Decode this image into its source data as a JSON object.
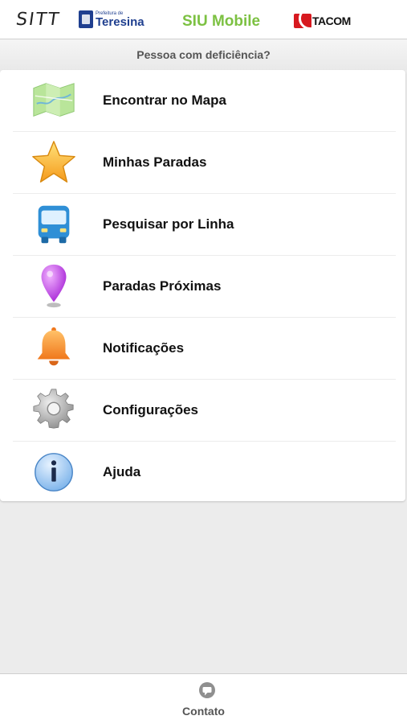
{
  "header": {
    "sitt_logo": "SITT",
    "teresina_small": "Prefeitura de",
    "teresina_name": "Teresina",
    "app_title": "SIU Mobile",
    "tacom_logo": "TACOM",
    "title_color": "#7cc142"
  },
  "accessibility_link": "Pessoa com deficiência?",
  "menu": {
    "items": [
      {
        "label": "Encontrar no Mapa",
        "icon": "map-icon"
      },
      {
        "label": "Minhas Paradas",
        "icon": "star-icon"
      },
      {
        "label": "Pesquisar por Linha",
        "icon": "bus-icon"
      },
      {
        "label": "Paradas Próximas",
        "icon": "location-pin-icon"
      },
      {
        "label": "Notificações",
        "icon": "bell-icon"
      },
      {
        "label": "Configurações",
        "icon": "gear-icon"
      },
      {
        "label": "Ajuda",
        "icon": "info-icon"
      }
    ]
  },
  "footer": {
    "contact_label": "Contato",
    "icon": "chat-bubble-icon"
  }
}
